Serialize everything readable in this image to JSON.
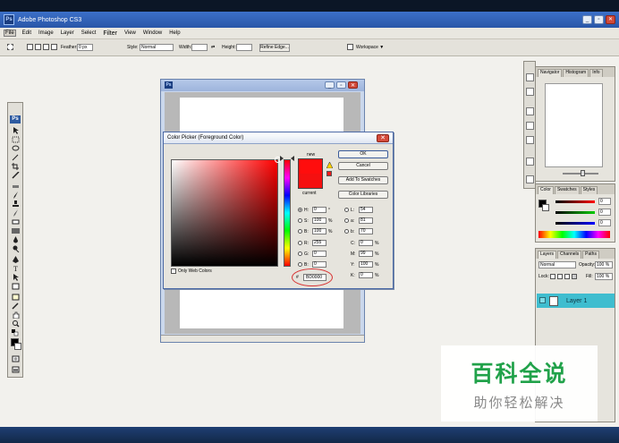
{
  "app": {
    "title": "Adobe Photoshop CS3",
    "icon_text": "Ps"
  },
  "window_buttons": {
    "minimize": "_",
    "restore": "▫",
    "close": "✕"
  },
  "menubar": [
    "File",
    "Edit",
    "Image",
    "Layer",
    "Select",
    "Filter",
    "View",
    "Window",
    "Help"
  ],
  "options_bar": {
    "feather_label": "Feather:",
    "feather_value": "0 px",
    "style_label": "Style:",
    "style_value": "Normal",
    "width_label": "Width:",
    "height_label": "Height:",
    "refine_edge": "Refine Edge...",
    "workspace": "Workspace ▼"
  },
  "tools": {
    "ps_label": "Ps"
  },
  "document": {
    "icon": "Ps"
  },
  "color_picker": {
    "title": "Color Picker (Foreground Color)",
    "new_label": "new",
    "current_label": "current",
    "only_web_colors": "Only Web Colors",
    "buttons": {
      "ok": "OK",
      "cancel": "Cancel",
      "add_swatches": "Add To Swatches",
      "color_libraries": "Color Libraries"
    },
    "hsb": [
      {
        "label": "H:",
        "value": "0",
        "unit": "°"
      },
      {
        "label": "S:",
        "value": "100",
        "unit": "%"
      },
      {
        "label": "B:",
        "value": "100",
        "unit": "%"
      }
    ],
    "rgb": [
      {
        "label": "R:",
        "value": "255"
      },
      {
        "label": "G:",
        "value": "0"
      },
      {
        "label": "B:",
        "value": "0"
      }
    ],
    "lab": [
      {
        "label": "L:",
        "value": "54"
      },
      {
        "label": "a:",
        "value": "81"
      },
      {
        "label": "b:",
        "value": "70"
      }
    ],
    "cmyk": [
      {
        "label": "C:",
        "value": "0",
        "unit": "%"
      },
      {
        "label": "M:",
        "value": "99",
        "unit": "%"
      },
      {
        "label": "Y:",
        "value": "100",
        "unit": "%"
      },
      {
        "label": "K:",
        "value": "0",
        "unit": "%"
      }
    ],
    "hex_prefix": "#",
    "hex_value": "BD0000"
  },
  "panels": {
    "navigator_tabs": [
      "Navigator",
      "Histogram",
      "Info"
    ],
    "color_tabs": [
      "Color",
      "Swatches",
      "Styles"
    ],
    "color_values": [
      "0",
      "0",
      "0"
    ],
    "layers_tabs": [
      "Layers",
      "Channels",
      "Paths"
    ],
    "blend_mode": "Normal",
    "opacity_label": "Opacity:",
    "opacity_value": "100 %",
    "lock_label": "Lock:",
    "fill_label": "Fill:",
    "fill_value": "100 %",
    "layer_name": "Layer 1"
  },
  "watermark": {
    "main": "百科全说",
    "sub": "助你轻松解决"
  }
}
